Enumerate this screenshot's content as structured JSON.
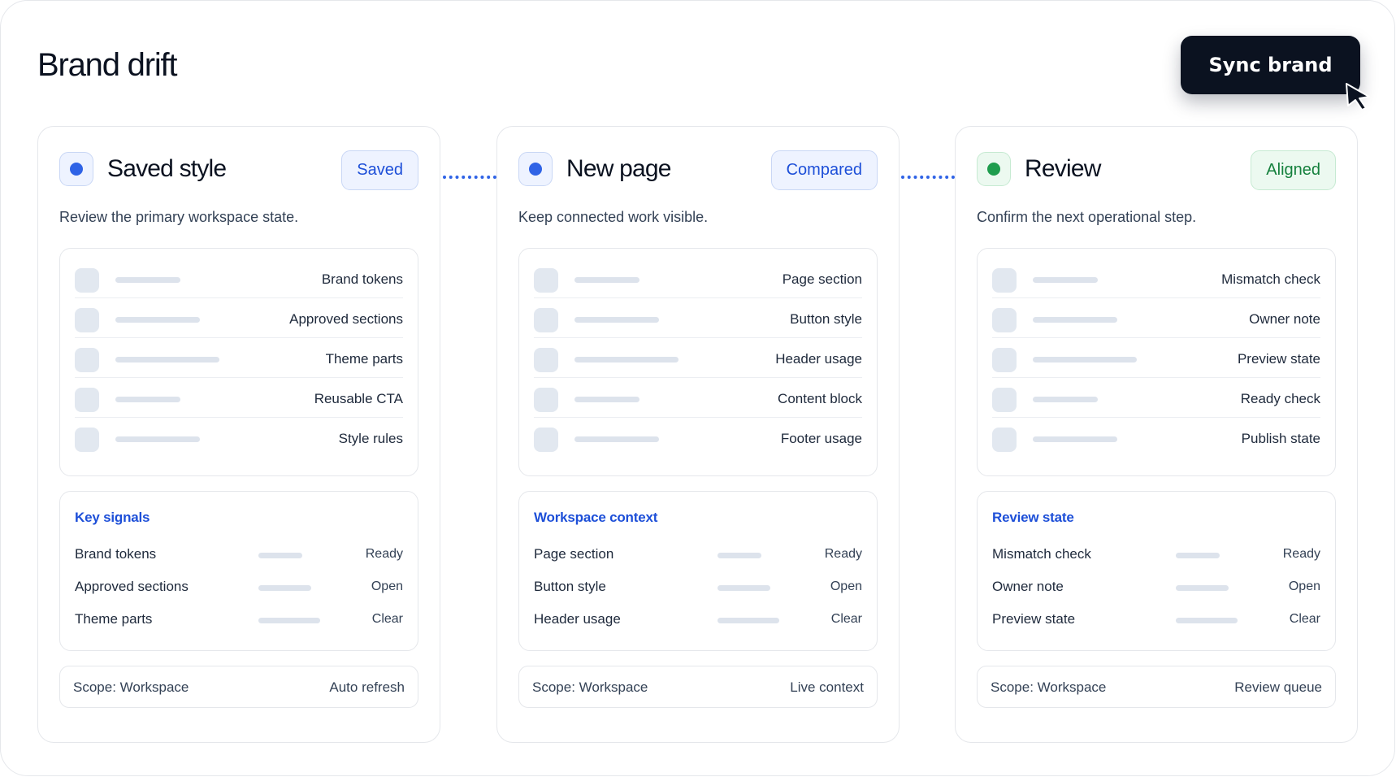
{
  "header": {
    "title": "Brand drift",
    "sync_label": "Sync brand"
  },
  "colors": {
    "accent": "#2f63e6",
    "success": "#1f9d4e",
    "dark": "#0b1220"
  },
  "cards": [
    {
      "title": "Saved style",
      "badge": "Saved",
      "tone": "blue",
      "desc": "Review the primary workspace state.",
      "rows": [
        "Brand tokens",
        "Approved sections",
        "Theme parts",
        "Reusable CTA",
        "Style rules"
      ],
      "signals_title": "Key signals",
      "signals": [
        {
          "label": "Brand tokens",
          "value": "Ready"
        },
        {
          "label": "Approved sections",
          "value": "Open"
        },
        {
          "label": "Theme parts",
          "value": "Clear"
        }
      ],
      "scope": "Scope: Workspace",
      "scope_right": "Auto refresh"
    },
    {
      "title": "New page",
      "badge": "Compared",
      "tone": "blue",
      "desc": "Keep connected work visible.",
      "rows": [
        "Page section",
        "Button style",
        "Header usage",
        "Content block",
        "Footer usage"
      ],
      "signals_title": "Workspace context",
      "signals": [
        {
          "label": "Page section",
          "value": "Ready"
        },
        {
          "label": "Button style",
          "value": "Open"
        },
        {
          "label": "Header usage",
          "value": "Clear"
        }
      ],
      "scope": "Scope: Workspace",
      "scope_right": "Live context"
    },
    {
      "title": "Review",
      "badge": "Aligned",
      "tone": "green",
      "desc": "Confirm the next operational step.",
      "rows": [
        "Mismatch check",
        "Owner note",
        "Preview state",
        "Ready check",
        "Publish state"
      ],
      "signals_title": "Review state",
      "signals": [
        {
          "label": "Mismatch check",
          "value": "Ready"
        },
        {
          "label": "Owner note",
          "value": "Open"
        },
        {
          "label": "Preview state",
          "value": "Clear"
        }
      ],
      "scope": "Scope: Workspace",
      "scope_right": "Review queue"
    }
  ]
}
